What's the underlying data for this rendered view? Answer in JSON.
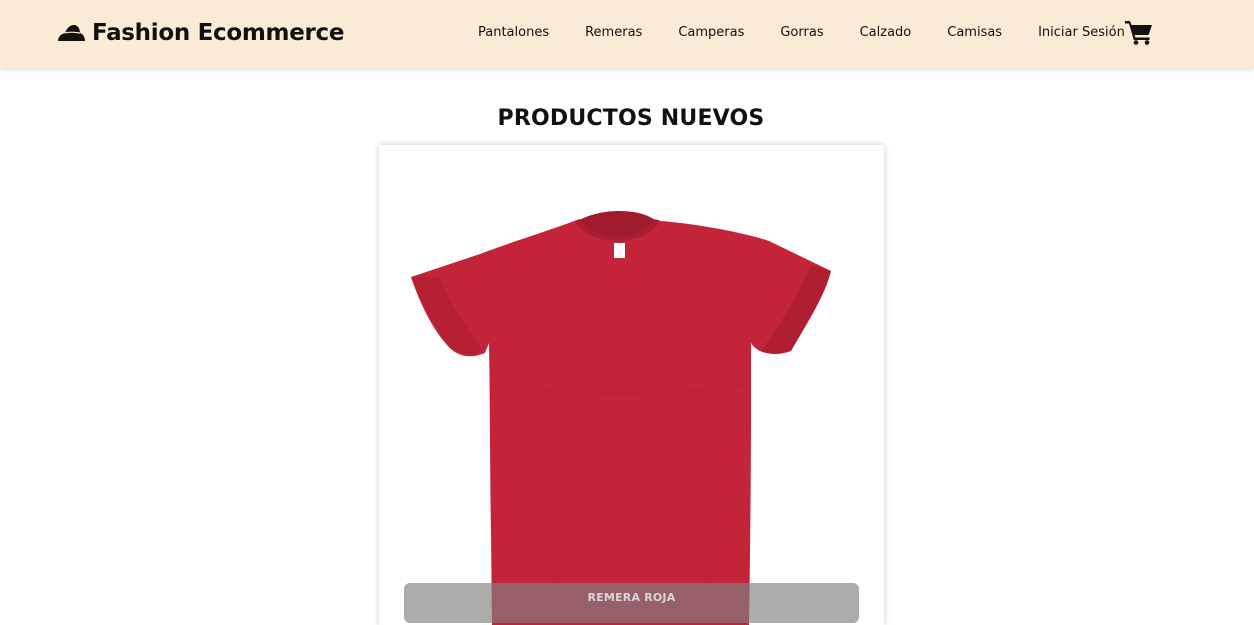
{
  "brand": {
    "title": "Fashion Ecommerce",
    "icon": "hat-icon"
  },
  "nav": {
    "links": [
      "Pantalones",
      "Remeras",
      "Camperas",
      "Gorras",
      "Calzado",
      "Camisas",
      "Iniciar Sesión"
    ],
    "cart_icon": "shopping-cart-icon"
  },
  "section": {
    "title": "PRODUCTOS NUEVOS"
  },
  "products": [
    {
      "name": "REMERA ROJA",
      "image": "red-tshirt"
    }
  ],
  "colors": {
    "navbar_bg": "#faebd7",
    "tshirt": "#c4243a",
    "text": "#111111"
  }
}
